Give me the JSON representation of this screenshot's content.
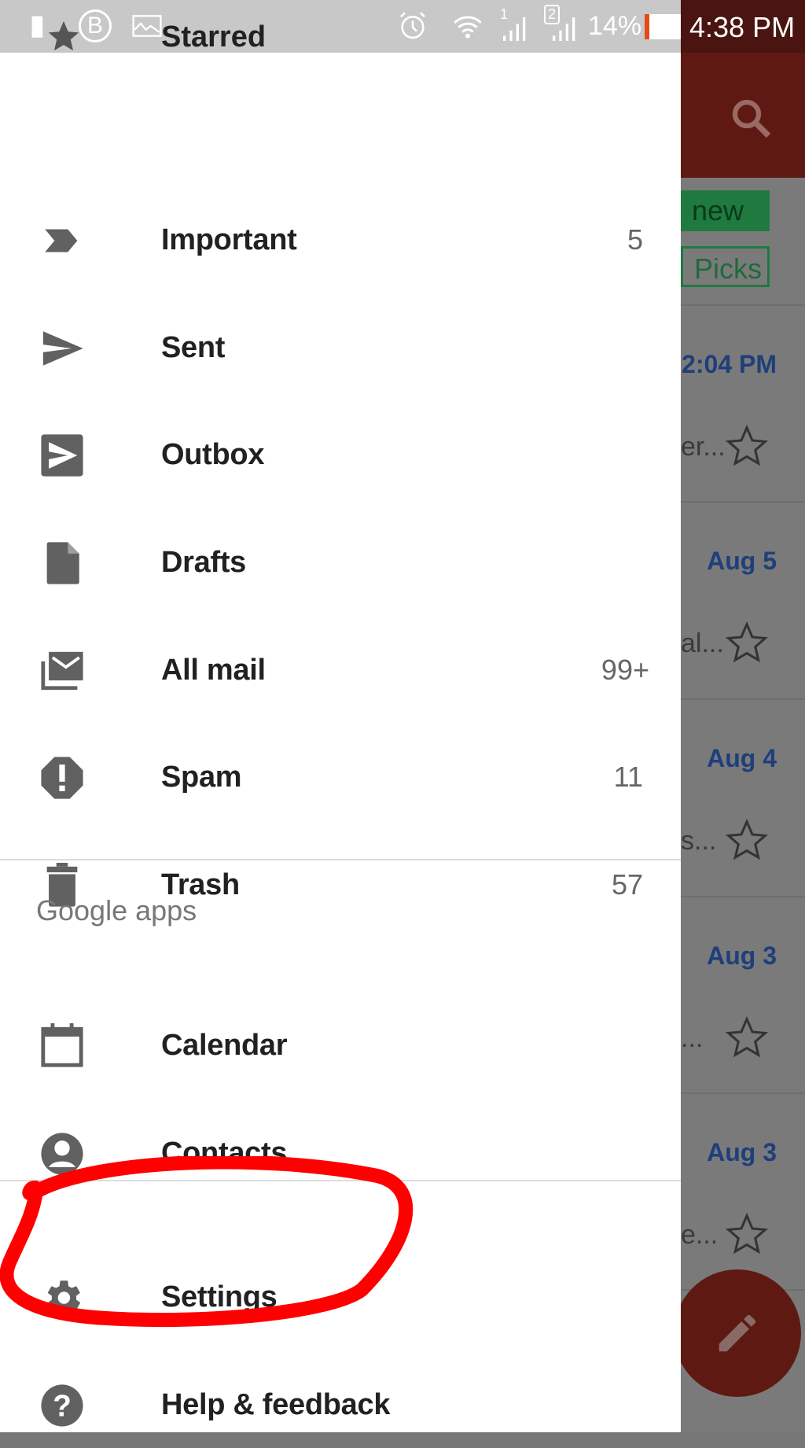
{
  "status_bar": {
    "battery_percent": "14%",
    "time": "4:38 PM",
    "sim1": "1",
    "sim2": "2",
    "icons": [
      "battery-alert-icon",
      "bbm-icon",
      "gallery-icon",
      "alarm-icon",
      "wifi-icon",
      "signal-icon",
      "battery-icon"
    ]
  },
  "drawer": {
    "partial_item": {
      "label": "Starred",
      "icon": "star-icon"
    },
    "items": [
      {
        "label": "Important",
        "count": "5",
        "icon": "important-icon"
      },
      {
        "label": "Sent",
        "count": "",
        "icon": "send-icon"
      },
      {
        "label": "Outbox",
        "count": "",
        "icon": "outbox-icon"
      },
      {
        "label": "Drafts",
        "count": "",
        "icon": "draft-icon"
      },
      {
        "label": "All mail",
        "count": "99+",
        "icon": "all-mail-icon"
      },
      {
        "label": "Spam",
        "count": "11",
        "icon": "spam-icon"
      },
      {
        "label": "Trash",
        "count": "57",
        "icon": "trash-icon"
      }
    ],
    "section_title": "Google apps",
    "apps": [
      {
        "label": "Calendar",
        "icon": "calendar-icon"
      },
      {
        "label": "Contacts",
        "icon": "contacts-icon"
      }
    ],
    "footer": [
      {
        "label": "Settings",
        "icon": "gear-icon"
      },
      {
        "label": "Help & feedback",
        "icon": "help-icon"
      }
    ]
  },
  "background": {
    "chips": [
      "new",
      "Picks"
    ],
    "rows": [
      {
        "date": "2:04 PM",
        "snippet": "er..."
      },
      {
        "date": "Aug 5",
        "snippet": "al..."
      },
      {
        "date": "Aug 4",
        "snippet": "s..."
      },
      {
        "date": "Aug 3",
        "snippet": "..."
      },
      {
        "date": "Aug 3",
        "snippet": "e..."
      }
    ]
  },
  "colors": {
    "annotation": "#ff0000",
    "app_bar": "#c62828",
    "chip": "#0f9d58"
  }
}
